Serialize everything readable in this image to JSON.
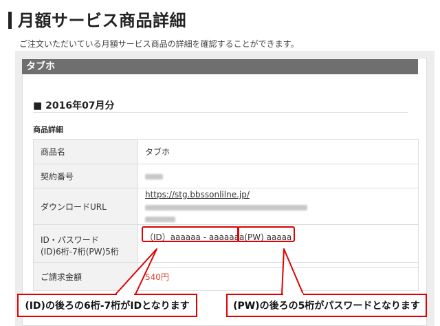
{
  "page": {
    "title": "月額サービス商品詳細",
    "subtitle": "ご注文いただいている月額サービス商品の詳細を確認することができます。"
  },
  "section": {
    "heading": "タブホ",
    "month": "■ 2016年07月分",
    "detail_label": "商品詳細"
  },
  "details": {
    "rows": [
      {
        "key": "商品名",
        "value": "タブホ"
      },
      {
        "key": "契約番号",
        "value": ""
      },
      {
        "key": "ダウンロードURL",
        "value": "https://stg.bbssonlilne.jp/"
      },
      {
        "key_line1": "ID・パスワード",
        "key_line2": "(ID)6桁-7桁(PW)5桁",
        "id_value": "（ID）aaaaaa - aaaaaaa",
        "pw_value": "(PW) aaaaa"
      }
    ]
  },
  "price": {
    "key": "ご請求金額",
    "value": "540円"
  },
  "callouts": {
    "id_note": "(ID)の後ろの6桁-7桁がIDとなります",
    "pw_note": "(PW)の後ろの5桁がパスワードとなります"
  },
  "colors": {
    "accent": "#e00000",
    "header_bg": "#6f6f6f",
    "price": "#e03c2c"
  }
}
